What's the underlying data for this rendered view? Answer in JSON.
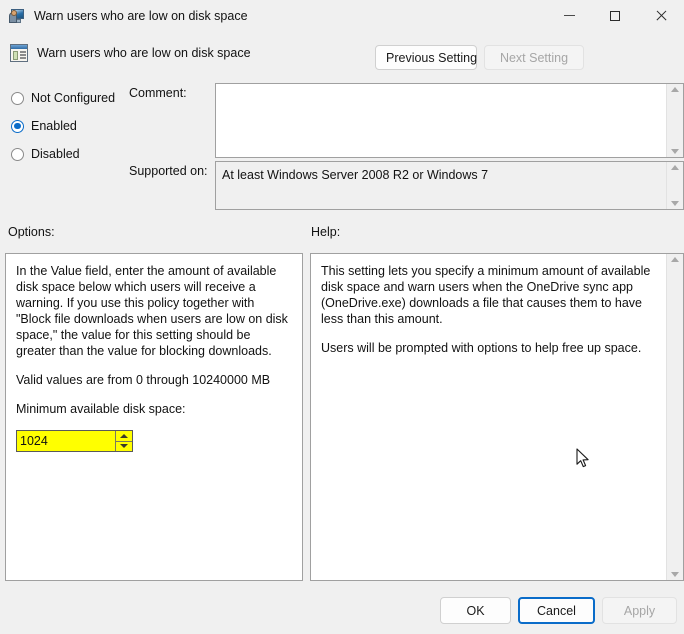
{
  "window": {
    "title": "Warn users who are low on disk space",
    "icon": "policy-monitor-icon",
    "minimize_label": "Minimize",
    "maximize_label": "Maximize",
    "close_label": "Close"
  },
  "header": {
    "title": "Warn users who are low on disk space",
    "icon": "policy-setting-icon",
    "previous_setting": "Previous Setting",
    "next_setting": "Next Setting",
    "next_setting_enabled": false
  },
  "state": {
    "options": [
      "Not Configured",
      "Enabled",
      "Disabled"
    ],
    "selected": "Enabled"
  },
  "comment": {
    "label": "Comment:",
    "value": "",
    "placeholder": ""
  },
  "supported": {
    "label": "Supported on:",
    "value": "At least Windows Server 2008 R2 or Windows 7"
  },
  "options_panel": {
    "label": "Options:",
    "paragraph1": "In the Value field, enter the amount of available disk space below which users will receive a warning. If you use this policy together with \"Block file downloads when users are low on disk space,\" the value for this setting should be greater than the value for blocking downloads.",
    "paragraph2": "Valid values are from 0 through 10240000 MB",
    "field_label": "Minimum available disk space:",
    "field_value": "1024",
    "field_highlight_color": "#ffff00",
    "spin_up": "Increase",
    "spin_down": "Decrease"
  },
  "help_panel": {
    "label": "Help:",
    "paragraph1": "This setting lets you specify a minimum amount of available disk space and warn users when the OneDrive sync app (OneDrive.exe) downloads a file that causes them to have less than this amount.",
    "paragraph2": "Users will be prompted with options to help free up space."
  },
  "footer": {
    "ok": "OK",
    "cancel": "Cancel",
    "apply": "Apply",
    "apply_enabled": false,
    "focused_button": "Cancel"
  },
  "colors": {
    "accent": "#0a6cc9",
    "window_bg": "#f0f0f0",
    "field_bg": "#ffffff",
    "highlight": "#ffff00",
    "disabled_text": "#a6a6a6"
  }
}
